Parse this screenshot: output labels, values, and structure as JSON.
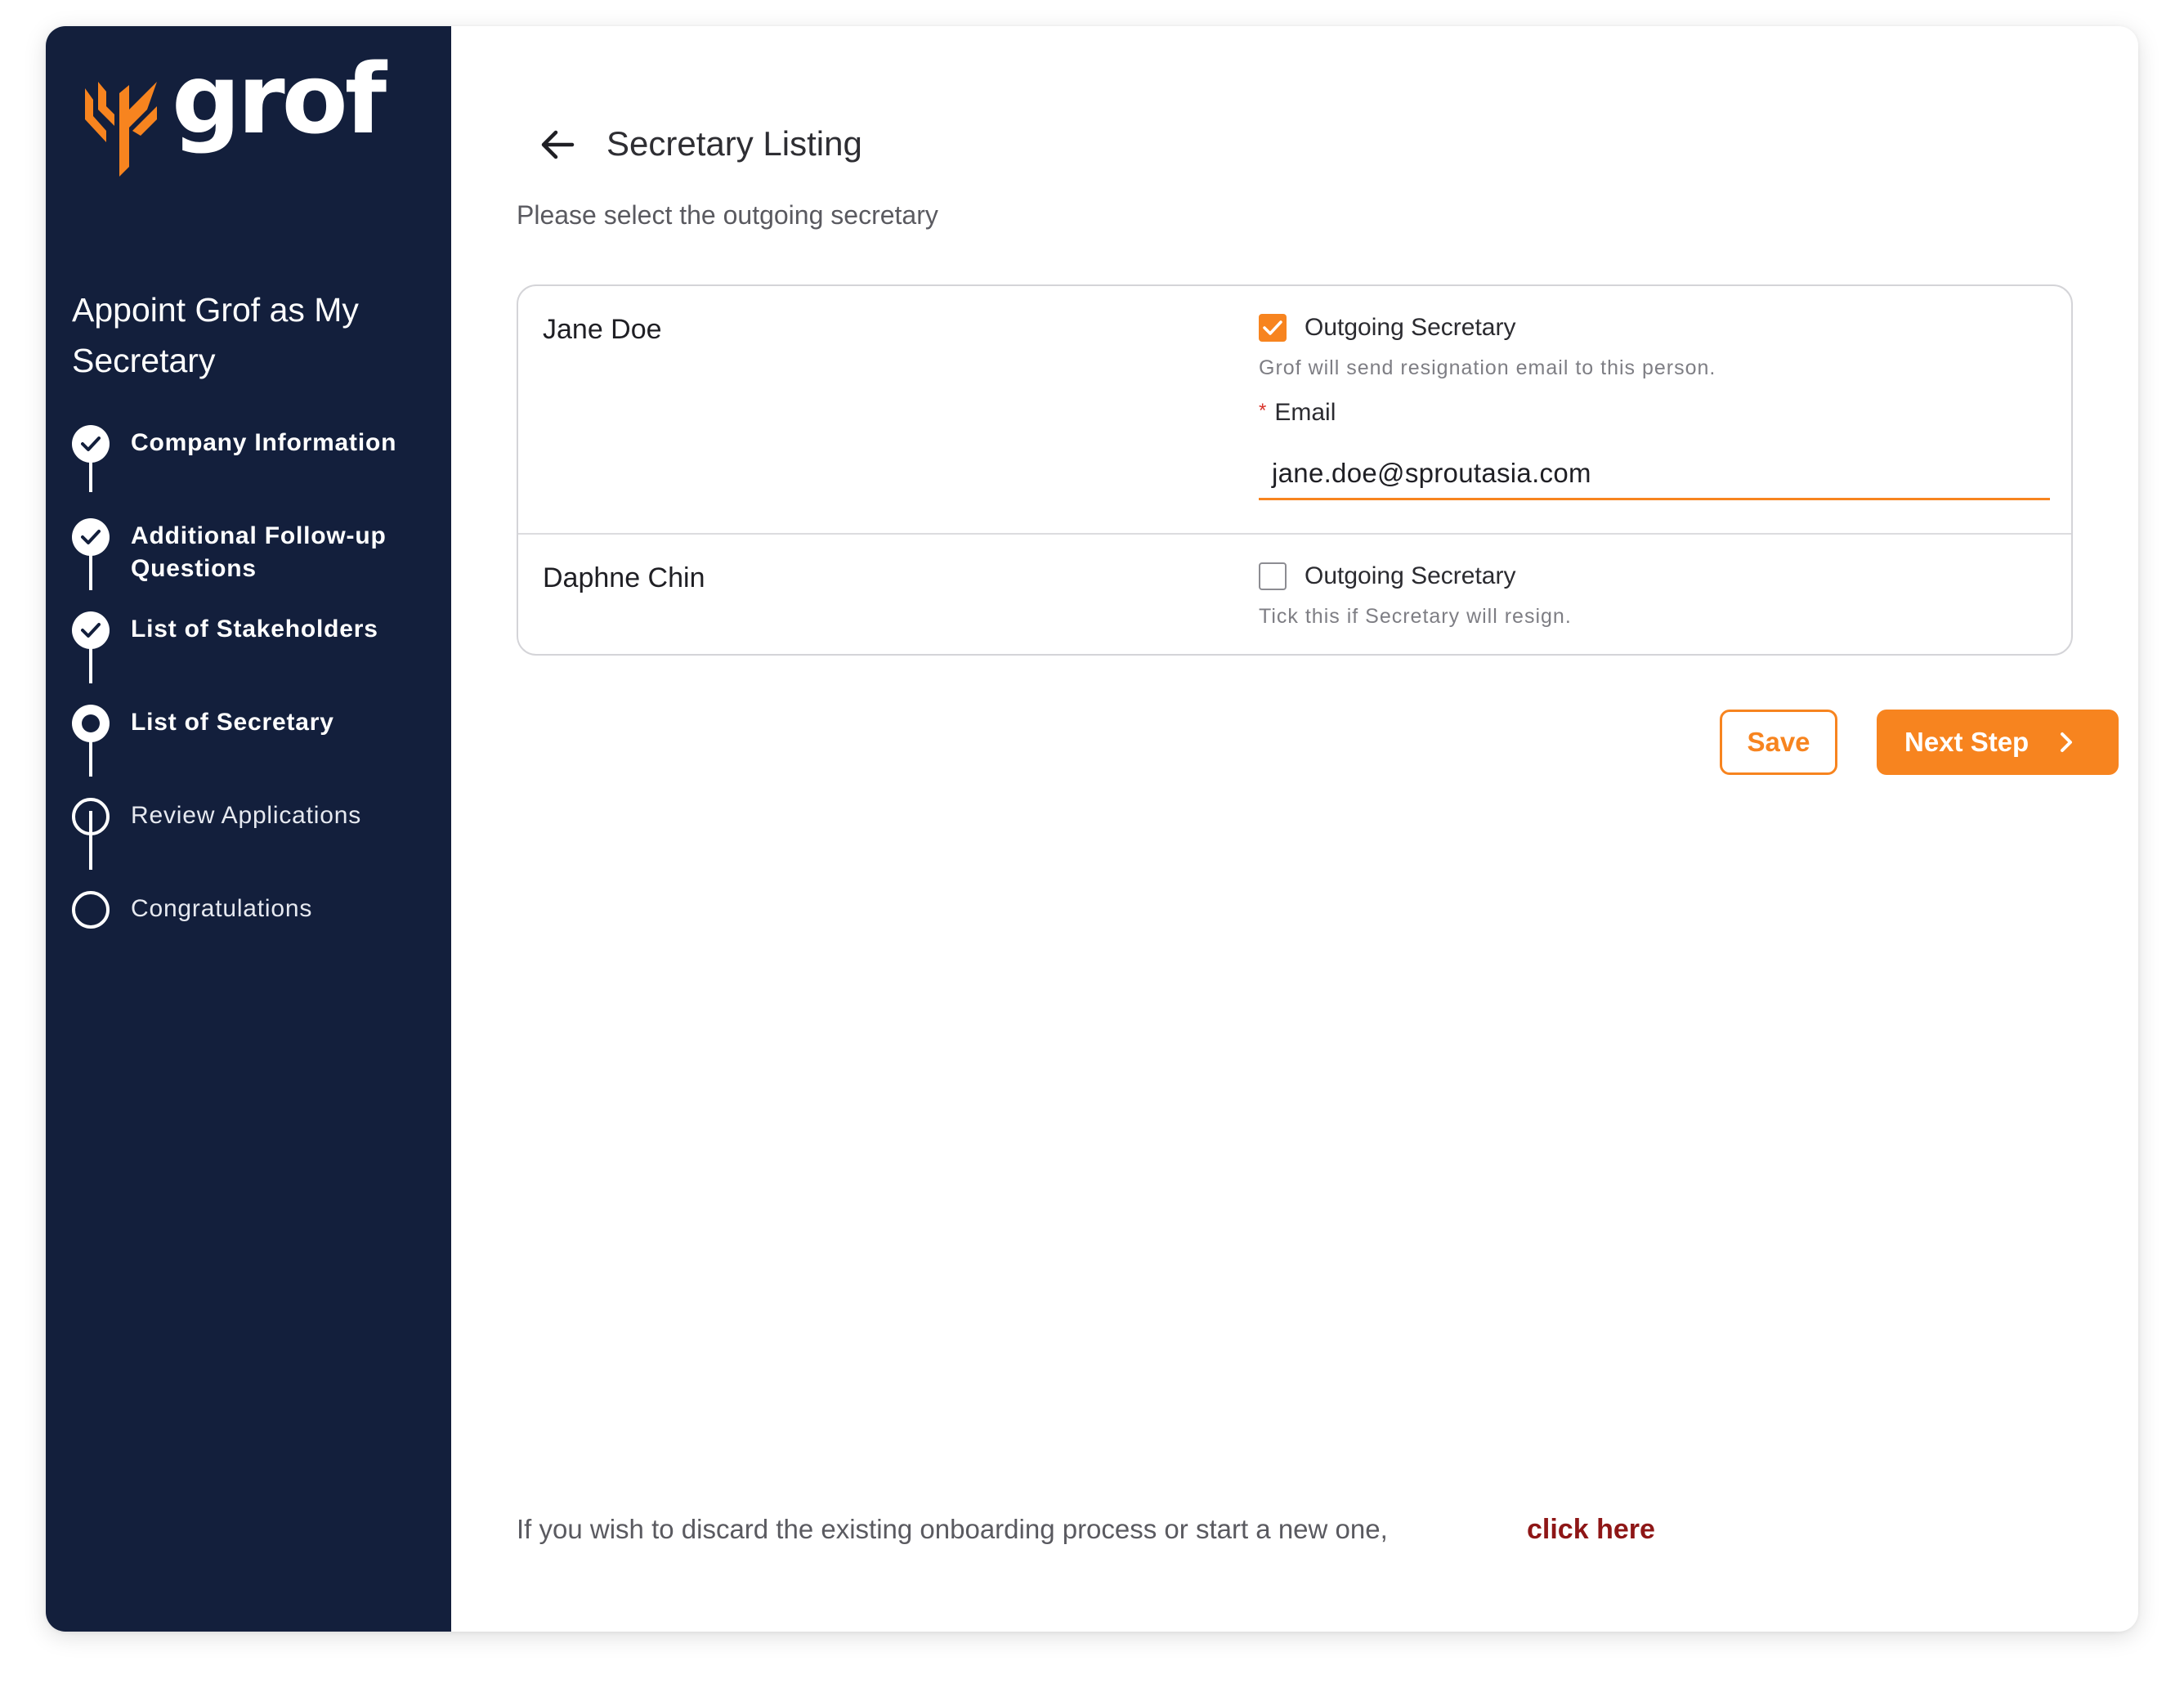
{
  "brand": {
    "name": "grof",
    "accent_color": "#f7841f",
    "sidebar_color": "#131f3c",
    "link_color": "#8e1616"
  },
  "sidebar": {
    "title": "Appoint Grof as My Secretary",
    "steps": [
      {
        "label": "Company Information",
        "status": "done"
      },
      {
        "label": "Additional Follow-up Questions",
        "status": "done"
      },
      {
        "label": "List of Stakeholders",
        "status": "done"
      },
      {
        "label": "List of Secretary",
        "status": "current"
      },
      {
        "label": "Review Applications",
        "status": "todo"
      },
      {
        "label": "Congratulations",
        "status": "todo"
      }
    ]
  },
  "header": {
    "back_icon": "arrow-left-icon",
    "title": "Secretary Listing",
    "subtitle": "Please select the outgoing secretary"
  },
  "secretaries": [
    {
      "name": "Jane Doe",
      "checkbox_label": "Outgoing Secretary",
      "checked": true,
      "hint": "Grof will send resignation email to this person.",
      "email_label": "Email",
      "email_required_mark": "*",
      "email_value": "jane.doe@sproutasia.com"
    },
    {
      "name": "Daphne Chin",
      "checkbox_label": "Outgoing Secretary",
      "checked": false,
      "hint": "Tick this if Secretary will resign."
    }
  ],
  "actions": {
    "save_label": "Save",
    "next_label": "Next Step",
    "next_icon": "chevron-right-icon"
  },
  "footer": {
    "text": "If you wish to discard the existing onboarding process or start a new one,",
    "link_label": "click here"
  }
}
